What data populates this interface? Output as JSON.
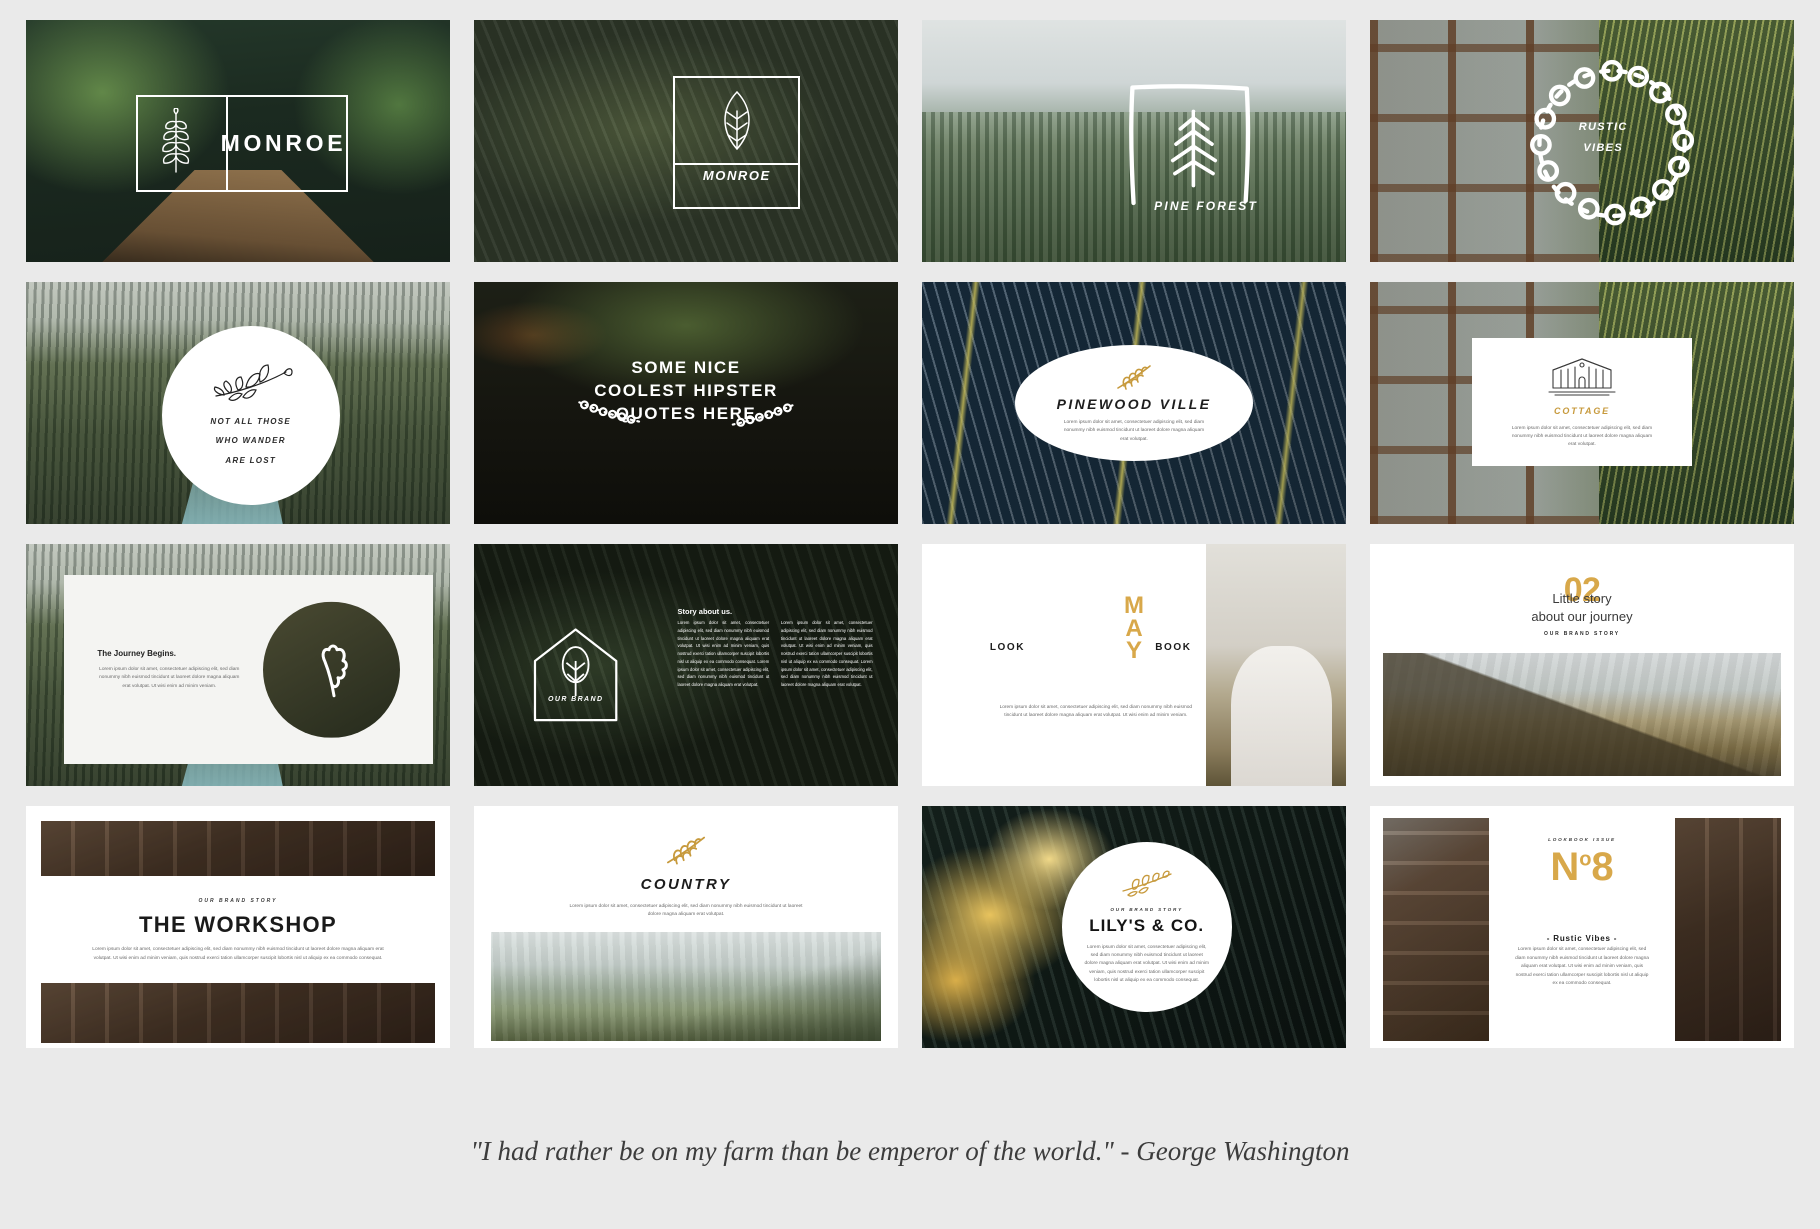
{
  "caption": "\"I had rather be on my farm than be emperor of the world.\" - George Washington",
  "colors": {
    "gold": "#d8a84a",
    "gold_script": "#c79a3d",
    "page_bg": "#eaeaea",
    "slide_bg": "#ffffff",
    "ink": "#1a1a1a"
  },
  "lorem": {
    "short": "Lorem ipsum dolor sit amet, consectetuer adipiscing elit, sed diam nonummy nibh euismod tincidunt ut laoreet dolore magna aliquam erat volutpat.",
    "medium": "Lorem ipsum dolor sit amet, consectetuer adipiscing elit, sed diam nonummy nibh euismod tincidunt ut laoreet dolore magna aliquam erat volutpat. Ut wisi enim ad minim veniam.",
    "long": "Lorem ipsum dolor sit amet, consectetuer adipiscing elit, sed diam nonummy nibh euismod tincidunt ut laoreet dolore magna aliquam erat volutpat. Ut wisi enim ad minim veniam, quis nostrud exerci tation ullamcorper suscipit lobortis nisl ut aliquip ex ea commodo consequat.",
    "column": "Lorem ipsum dolor sit amet, consectetuer adipiscing elit, sed diam nonummy nibh euismod tincidunt ut laoreet dolore magna aliquam erat volutpat. Ut wisi enim ad minim veniam, quis nostrud exerci tation ullamcorper suscipit lobortis nisl ut aliquip ex ea commodo consequat. Lorem ipsum dolor sit amet, consectetuer adipiscing elit, sed diam nonummy nibh euismod tincidunt ut laoreet dolore magna aliquam erat volutpat."
  },
  "slides": [
    {
      "id": "slide-01-monroe-bridge",
      "brand": "MONROE",
      "icon": "fern-leaf-icon",
      "background": "forest-bridge-photo"
    },
    {
      "id": "slide-02-monroe-leaf",
      "brand": "MONROE",
      "icon": "leaf-outline-icon",
      "background": "tall-grass-photo"
    },
    {
      "id": "slide-03-pine-forest",
      "title": "PINE FOREST",
      "icon": "pine-tree-icon",
      "background": "misty-pine-forest-photo"
    },
    {
      "id": "slide-04-rustic-vibes",
      "line1": "RUSTIC",
      "line2": "VIBES",
      "icon": "laurel-wreath-icon",
      "background": "greenhouse-agave-photo"
    },
    {
      "id": "slide-05-wander-quote",
      "line1": "NOT ALL THOSE",
      "line2": "WHO WANDER",
      "line3": "ARE LOST",
      "icon": "botanical-sprig-icon",
      "background": "canyon-river-photo"
    },
    {
      "id": "slide-06-hipster-quotes",
      "line1": "SOME NICE",
      "line2": "COOLEST HIPSTER",
      "line3": "QUOTES HERE",
      "icon": "garland-icon",
      "background": "man-on-bench-photo"
    },
    {
      "id": "slide-07-pinewood-ville",
      "title": "PINEWOOD VILLE",
      "icon": "gold-fern-icon",
      "body": "short",
      "background": "dark-palm-frond-photo"
    },
    {
      "id": "slide-08-cottage",
      "title": "COTTAGE",
      "icon": "cottage-house-icon",
      "body": "short",
      "background": "greenhouse-agave-photo"
    },
    {
      "id": "slide-09-journey-begins",
      "heading": "The Journey Begins.",
      "icon": "oak-leaf-icon",
      "body": "medium",
      "background": "canyon-river-photo"
    },
    {
      "id": "slide-10-our-brand",
      "badge": "OUR BRAND",
      "heading": "Story about us.",
      "icon": "house-tree-icon",
      "body": "column",
      "background": "dark-grass-photo"
    },
    {
      "id": "slide-11-may-lookbook",
      "month": "MAY",
      "left_word": "LOOK",
      "right_word": "BOOK",
      "body": "medium",
      "background": "cliff-portrait-photo"
    },
    {
      "id": "slide-12-little-story",
      "number": "02",
      "line1": "Little story",
      "line2": "about our journey",
      "eyebrow": "OUR BRAND STORY",
      "background": "mountain-road-photo"
    },
    {
      "id": "slide-13-the-workshop",
      "eyebrow": "OUR BRAND STORY",
      "title": "THE WORKSHOP",
      "body": "long",
      "background": "workshop-tools-photo"
    },
    {
      "id": "slide-14-country",
      "title": "COUNTRY",
      "icon": "gold-fern-icon",
      "body": "short",
      "background": "misty-valley-photo"
    },
    {
      "id": "slide-15-lilys-and-co",
      "eyebrow": "OUR BRAND STORY",
      "title": "LILY'S & CO.",
      "icon": "gold-sprig-icon",
      "body": "long",
      "background": "yellow-tulips-photo"
    },
    {
      "id": "slide-16-no8",
      "eyebrow": "LOOKBOOK ISSUE",
      "number_prefix": "N",
      "number_sup": "o",
      "number_value": "8",
      "title": "- Rustic Vibes -",
      "body": "long",
      "background": "rustic-tools-photo"
    }
  ]
}
